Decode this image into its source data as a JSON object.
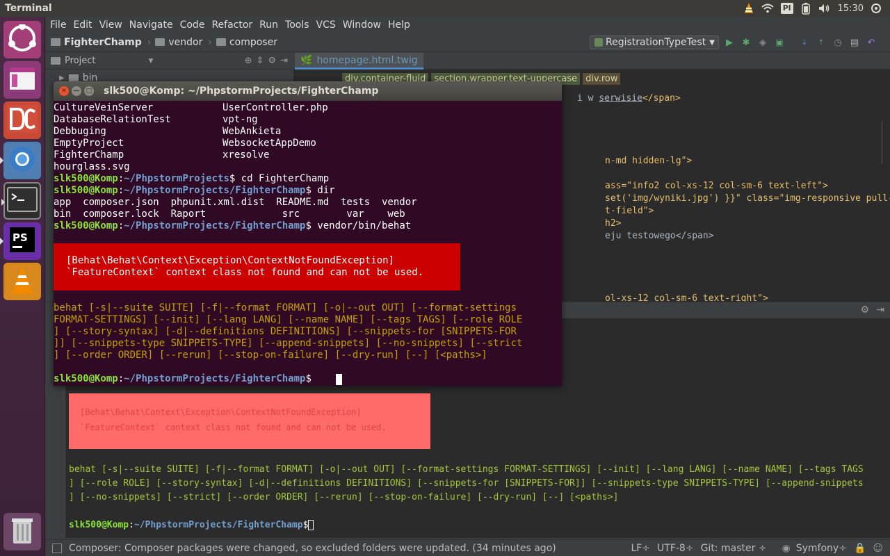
{
  "top_panel": {
    "app_title": "Terminal",
    "keyboard_indicator": "Pl",
    "clock": "15:30"
  },
  "launcher": {
    "items": [
      {
        "name": "Ubuntu Dash",
        "icon": "ubuntu-icon"
      },
      {
        "name": "Files",
        "icon": "window-icon"
      },
      {
        "name": "DC",
        "icon": "dc-icon"
      },
      {
        "name": "Chromium",
        "icon": "chromium-icon"
      },
      {
        "name": "Terminal",
        "icon": "terminal-icon"
      },
      {
        "name": "PhpStorm",
        "icon": "phpstorm-icon",
        "label": "PS"
      },
      {
        "name": "VLC",
        "icon": "vlc-icon"
      },
      {
        "name": "Trash",
        "icon": "trash-icon"
      }
    ]
  },
  "ide": {
    "menu": [
      "File",
      "Edit",
      "View",
      "Navigate",
      "Code",
      "Refactor",
      "Run",
      "Tools",
      "VCS",
      "Window",
      "Help"
    ],
    "breadcrumbs": [
      "FighterChamp",
      "vendor",
      "composer"
    ],
    "run_config": "RegistrationTypeTest",
    "project_panel": {
      "title": "Project",
      "tree_item": "bin"
    },
    "editor_tab": "homepage.html.twig",
    "tag_crumbs": [
      "div.container-fluid",
      "section.wrapper.text-uppercase",
      "div.row"
    ],
    "code_lines": [
      {
        "text": "i w ",
        "underlined": "serwisie",
        "tail": "</span>"
      },
      {
        "text": "n-md hidden-lg\">"
      },
      {
        "text": "ass=\"info2 col-xs-12 col-sm-6 text-left\">"
      },
      {
        "text": "set('img/wyniki.jpg') }}\" class=\"img-responsive pull-left\">"
      },
      {
        "text": "t-field\">"
      },
      {
        "text": "h2>"
      },
      {
        "text": "eju testowego</span>"
      },
      {
        "text": "ol-xs-12 col-sm-6 text-right\">"
      }
    ],
    "terminal": {
      "error_line_1": "[Behat\\Behat\\Context\\Exception\\ContextNotFoundException]",
      "error_line_2": "`FeatureContext` context class not found and can not be used.",
      "usage_1": "behat [-s|--suite SUITE] [-f|--format FORMAT] [-o|--out OUT] [--format-settings FORMAT-SETTINGS] [--init] [--lang LANG] [--name NAME] [--tags TAGS",
      "usage_2": "] [--role ROLE] [--story-syntax] [-d|--definitions DEFINITIONS] [--snippets-for [SNIPPETS-FOR]] [--snippets-type SNIPPETS-TYPE] [--append-snippets",
      "usage_3": "] [--no-snippets] [--strict] [--order ORDER] [--rerun] [--stop-on-failure] [--dry-run] [--] [<paths>]",
      "prompt_user": "slk500@Komp",
      "prompt_path": "~/PhpstormProjects/FighterChamp",
      "prompt_symbol": "$"
    },
    "status": {
      "message": "Composer: Composer packages were changed, so excluded folders were updated. (34 minutes ago)",
      "line_sep": "LF÷",
      "encoding": "UTF-8÷",
      "git": "Git: master ÷",
      "framework": "Symfony÷"
    }
  },
  "term_window": {
    "title": "slk500@Komp: ~/PhpstormProjects/FighterChamp",
    "ls_rows": [
      [
        "CultureVeinServer",
        "UserController.php"
      ],
      [
        "DatabaseRelationTest",
        "vpt-ng"
      ],
      [
        "Debbuging",
        "WebAnkieta"
      ],
      [
        "EmptyProject",
        "WebsocketAppDemo"
      ],
      [
        "FighterChamp",
        "xresolve"
      ],
      [
        "hourglass.svg",
        ""
      ]
    ],
    "prompt_user": "slk500@Komp",
    "path_home": "~/PhpstormProjects",
    "path_project": "~/PhpstormProjects/FighterChamp",
    "cmd_cd": " cd FighterChamp",
    "cmd_dir": " dir",
    "cmd_behat": " vendor/bin/behat",
    "dir_row_1": "app  composer.json  phpunit.xml.dist  README.md  tests  vendor",
    "dir_row_2": "bin  composer.lock  Raport             src        var    web",
    "error_line_1": "[Behat\\Behat\\Context\\Exception\\ContextNotFoundException]",
    "error_line_2": "`FeatureContext` context class not found and can not be used.",
    "usage_1": "behat [-s|--suite SUITE] [-f|--format FORMAT] [-o|--out OUT] [--format-settings",
    "usage_2": "FORMAT-SETTINGS] [--init] [--lang LANG] [--name NAME] [--tags TAGS] [--role ROLE",
    "usage_3": "] [--story-syntax] [-d|--definitions DEFINITIONS] [--snippets-for [SNIPPETS-FOR",
    "usage_4": "]] [--snippets-type SNIPPETS-TYPE] [--append-snippets] [--no-snippets] [--strict",
    "usage_5": "] [--order ORDER] [--rerun] [--stop-on-failure] [--dry-run] [--] [<paths>]"
  }
}
